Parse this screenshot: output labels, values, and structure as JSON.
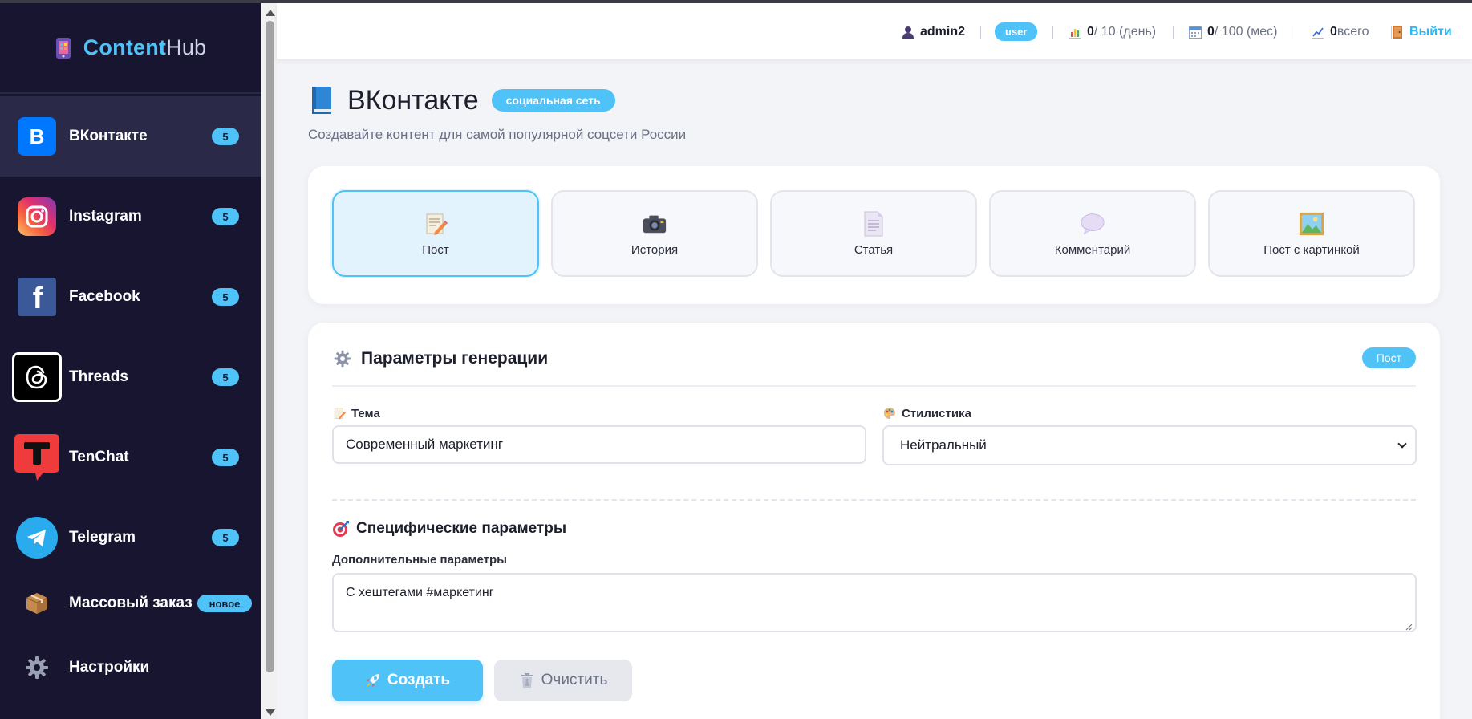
{
  "app": {
    "logo_part1": "Content",
    "logo_part2": "Hub"
  },
  "sidebar": {
    "items": [
      {
        "label": "ВКонтакте",
        "badge": "5",
        "icon": "vk-icon",
        "active": true
      },
      {
        "label": "Instagram",
        "badge": "5",
        "icon": "instagram-icon"
      },
      {
        "label": "Facebook",
        "badge": "5",
        "icon": "facebook-icon"
      },
      {
        "label": "Threads",
        "badge": "5",
        "icon": "threads-icon"
      },
      {
        "label": "TenChat",
        "badge": "5",
        "icon": "tenchat-icon"
      },
      {
        "label": "Telegram",
        "badge": "5",
        "icon": "telegram-icon"
      },
      {
        "label": "Массовый заказ",
        "badge": "новое",
        "icon": "package-icon"
      },
      {
        "label": "Настройки",
        "icon": "gear-icon"
      }
    ]
  },
  "topbar": {
    "username": "admin2",
    "role": "user",
    "daily_used": "0",
    "daily_limit": " / 10 (день)",
    "monthly_used": "0",
    "monthly_limit": " / 100 (мес)",
    "total": "0",
    "total_label": " всего",
    "logout": "Выйти"
  },
  "page": {
    "title": "ВКонтакте",
    "badge": "социальная сеть",
    "subtitle": "Создавайте контент для самой популярной соцсети России"
  },
  "content_types": [
    {
      "label": "Пост",
      "icon": "memo-icon",
      "active": true
    },
    {
      "label": "История",
      "icon": "camera-icon"
    },
    {
      "label": "Статья",
      "icon": "document-icon"
    },
    {
      "label": "Комментарий",
      "icon": "speech-bubble-icon"
    },
    {
      "label": "Пост с картинкой",
      "icon": "picture-icon"
    }
  ],
  "params": {
    "title": "Параметры генерации",
    "mode_badge": "Пост",
    "topic_label": "Тема",
    "topic_value": "Современный маркетинг",
    "style_label": "Стилистика",
    "style_value": "Нейтральный",
    "specific_title": "Специфические параметры",
    "extra_label": "Дополнительные параметры",
    "extra_value": "С хештегами #маркетинг",
    "create_button": "Создать",
    "clear_button": "Очистить"
  },
  "colors": {
    "accent": "#4fc3f7",
    "sidebar_bg": "#171530",
    "sidebar_active": "#2a2947"
  }
}
